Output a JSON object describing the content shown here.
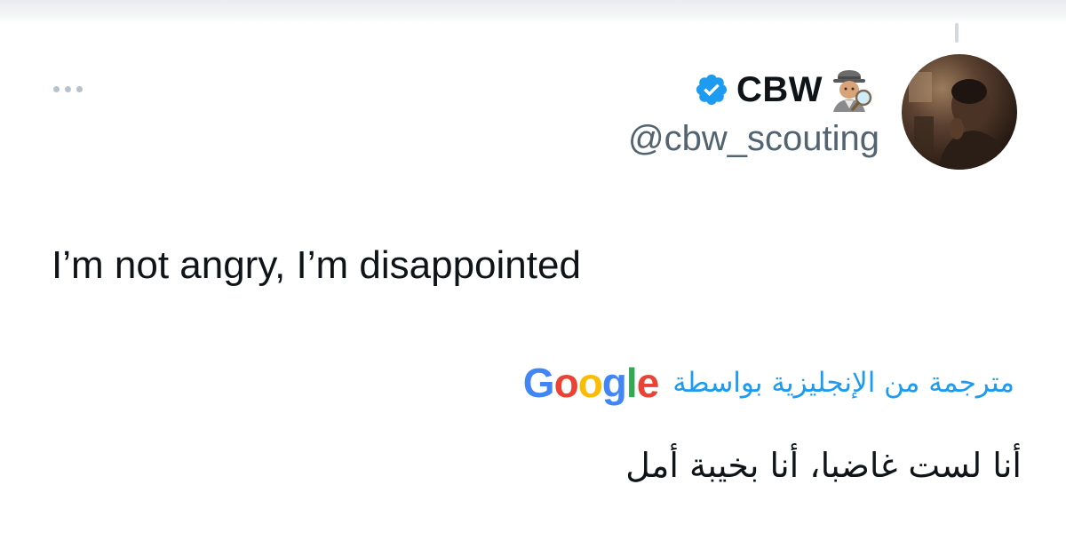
{
  "tweet": {
    "author": {
      "display_name": "CBW",
      "handle": "@cbw_scouting",
      "verified_icon": "verified-badge-icon",
      "name_emoji": "detective-emoji-icon",
      "avatar": "avatar-photo"
    },
    "text": "I’m not angry, I’m disappointed",
    "translation": {
      "label": "مترجمة من الإنجليزية بواسطة",
      "provider": "Google",
      "text": "أنا لست غاضبا، أنا بخيبة أمل"
    },
    "more_icon": "more-options-icon"
  },
  "colors": {
    "link_blue": "#1d9bf0",
    "secondary_text": "#536471",
    "primary_text": "#0f1419",
    "verified_blue": "#1d9bf0"
  }
}
